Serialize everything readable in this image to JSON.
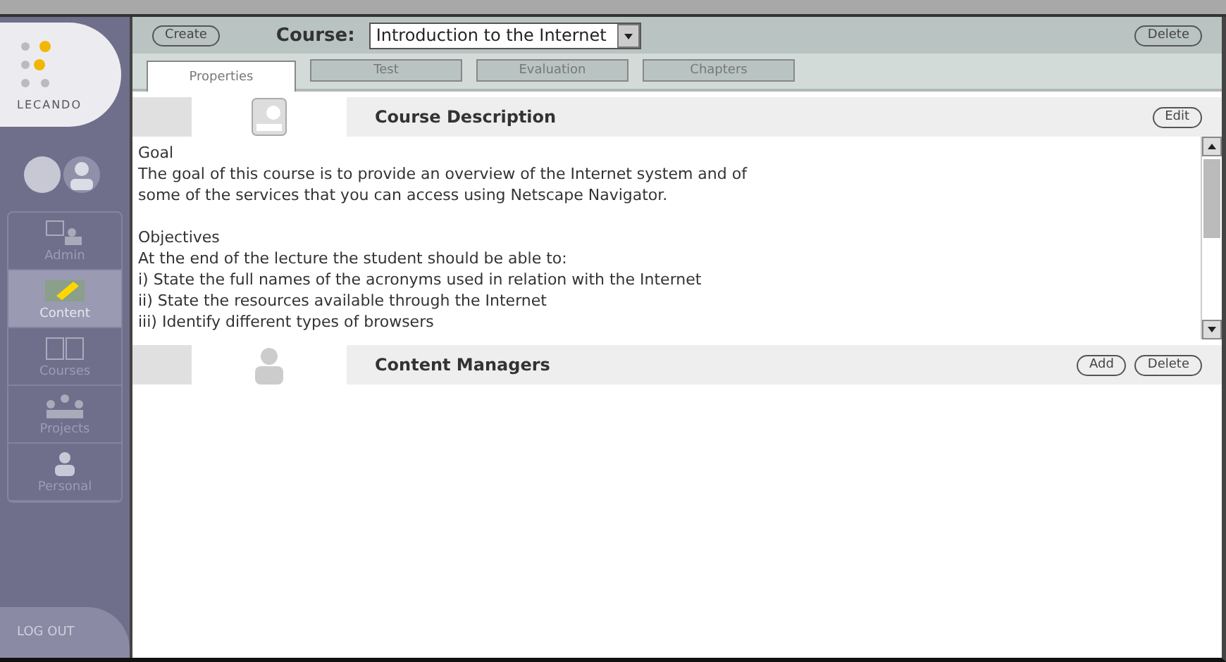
{
  "logo": {
    "text": "LECANDO"
  },
  "sidebar": {
    "items": [
      {
        "label": "Admin",
        "selected": false
      },
      {
        "label": "Content",
        "selected": true
      },
      {
        "label": "Courses",
        "selected": false
      },
      {
        "label": "Projects",
        "selected": false
      },
      {
        "label": "Personal",
        "selected": false
      }
    ],
    "logout": "LOG OUT"
  },
  "toolbar": {
    "create": "Create",
    "course_label": "Course:",
    "course_value": "Introduction to the Internet",
    "delete": "Delete"
  },
  "tabs": [
    {
      "label": "Properties",
      "selected": true
    },
    {
      "label": "Test",
      "selected": false
    },
    {
      "label": "Evaluation",
      "selected": false
    },
    {
      "label": "Chapters",
      "selected": false
    }
  ],
  "description": {
    "title": "Course Description",
    "edit": "Edit",
    "paragraphs": [
      [
        "Goal",
        "The goal of this course is to provide an overview of the Internet system and of",
        "some of the services that you can access using Netscape Navigator."
      ],
      [
        "Objectives",
        "At the end of the lecture the student should be able to:",
        "i) State the full names of the acronyms used in relation with the Internet",
        "ii) State the resources available through the Internet",
        "iii) Identify different types of browsers"
      ]
    ]
  },
  "managers": {
    "title": "Content Managers",
    "add": "Add",
    "delete": "Delete"
  }
}
